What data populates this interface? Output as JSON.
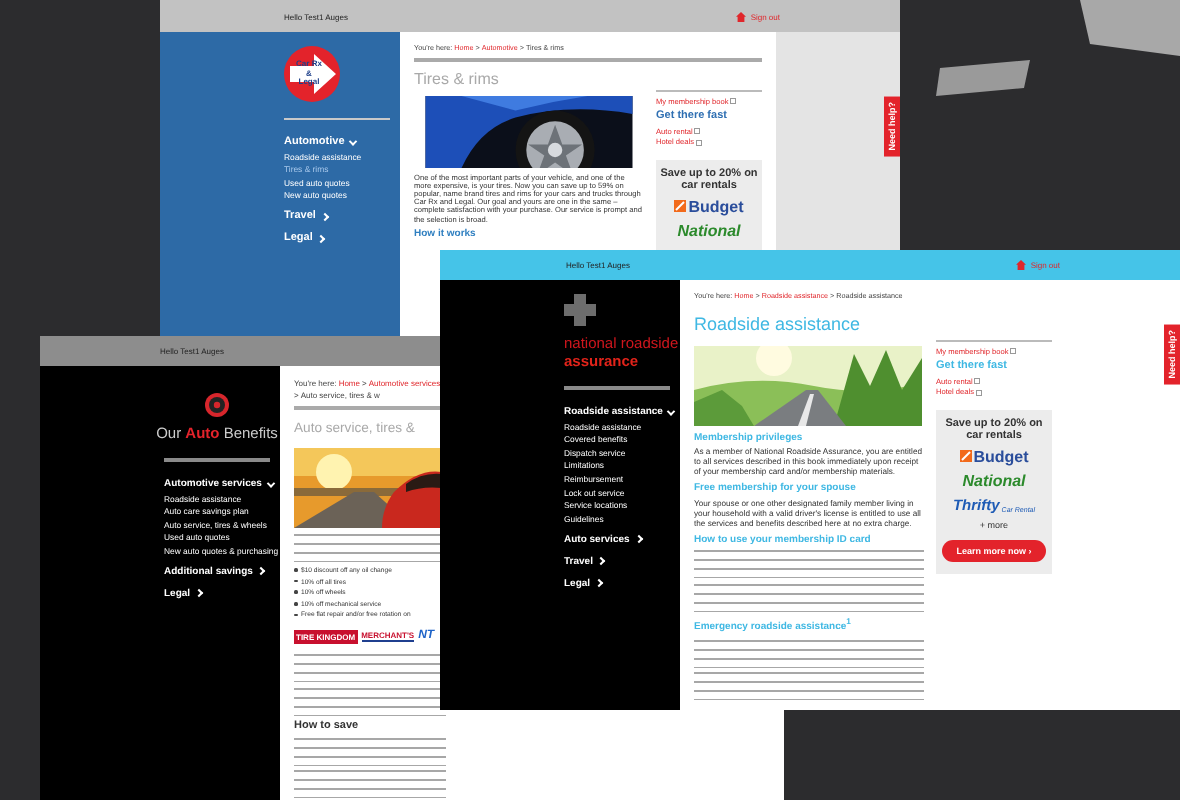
{
  "background": {
    "kind": "picture"
  },
  "pages": [
    {
      "kind": "carrx",
      "greeting": "Hello Test1 Auges",
      "sign_out": "Sign out",
      "logo": {
        "kind": "arrow_badge",
        "text": "Car Rx & Legal"
      },
      "nav": [
        {
          "label": "Automotive",
          "expanded": true,
          "children": [
            {
              "label": "Roadside assistance",
              "selected": false
            },
            {
              "label": "Tires & rims",
              "selected": true
            },
            {
              "label": "Used auto quotes",
              "selected": false
            },
            {
              "label": "New auto quotes",
              "selected": false
            }
          ]
        },
        {
          "label": "Travel",
          "expanded": false
        },
        {
          "label": "Legal",
          "expanded": false
        }
      ],
      "breadcrumb": [
        {
          "text": "You're here:",
          "kind": "plain"
        },
        {
          "text": "Home",
          "kind": "link"
        },
        {
          "text": ">",
          "kind": "plain"
        },
        {
          "text": "Automotive",
          "kind": "link"
        },
        {
          "text": ">",
          "kind": "plain"
        },
        {
          "text": "Tires & rims",
          "kind": "plain"
        }
      ],
      "title": "Tires & rims",
      "blocks": [
        {
          "kind": "picture"
        },
        {
          "kind": "paragraph",
          "text": "One of the most important parts of your vehicle, and one of the more expensive, is your tires. Now you can save up to 59% on popular, name brand tires and rims for your cars and trucks through Car Rx and Legal. Our goal and yours are one in the same – complete satisfaction with your purchase. Our service is prompt and the selection is broad."
        },
        {
          "kind": "heading",
          "text": "How it works"
        }
      ],
      "side_links": [
        {
          "kind": "link",
          "text": "My membership book"
        },
        {
          "kind": "heading",
          "text": "Get there fast"
        },
        {
          "kind": "link",
          "text": "Auto rental"
        },
        {
          "kind": "link",
          "text": "Hotel deals"
        }
      ],
      "ad": {
        "headline": "Save up to 20% on car rentals",
        "brands": [
          {
            "kind": "budget",
            "text": "Budget"
          },
          {
            "kind": "national",
            "text": "National"
          }
        ]
      },
      "help_tab": "Need help?"
    },
    {
      "kind": "benefits",
      "greeting": "Hello Test1 Auges",
      "logo": {
        "kind": "gear",
        "text": "Our **Auto** Benefits"
      },
      "nav": [
        {
          "label": "Automotive services",
          "expanded": true,
          "children": [
            {
              "label": "Roadside assistance",
              "selected": false
            },
            {
              "label": "Auto care savings plan",
              "selected": false
            },
            {
              "label": "Auto service, tires & wheels",
              "selected": false
            },
            {
              "label": "Used auto quotes",
              "selected": false
            },
            {
              "label": "New auto quotes & purchasing",
              "selected": false
            }
          ]
        },
        {
          "label": "Additional savings",
          "expanded": false
        },
        {
          "label": "Legal",
          "expanded": false
        }
      ],
      "breadcrumb": [
        {
          "text": "You're here:",
          "kind": "plain"
        },
        {
          "text": "Home",
          "kind": "link"
        },
        {
          "text": ">",
          "kind": "plain"
        },
        {
          "text": "Automotive services",
          "kind": "link"
        },
        {
          "text": ">",
          "kind": "plain"
        },
        {
          "text": "Auto service, tires & w",
          "kind": "plain"
        }
      ],
      "title": "Auto service, tires &",
      "blocks": [
        {
          "kind": "picture"
        },
        {
          "kind": "lines"
        },
        {
          "kind": "bullets",
          "items": [
            "$10 discount off any oil change",
            "10% off all tires",
            "10% off wheels",
            "10% off mechanical service",
            "Free flat repair and/or free rotation on"
          ]
        },
        {
          "kind": "brand_logos",
          "items": [
            {
              "kind": "tire_kingdom",
              "text": "TIRE KINGDOM"
            },
            {
              "kind": "merchants",
              "text": "MERCHANT'S"
            },
            {
              "kind": "ntb",
              "text": "NT"
            }
          ]
        },
        {
          "kind": "lines"
        },
        {
          "kind": "lines"
        },
        {
          "kind": "heading",
          "text": "How to save"
        },
        {
          "kind": "lines"
        },
        {
          "kind": "lines"
        }
      ]
    },
    {
      "kind": "roadside",
      "greeting": "Hello Test1 Auges",
      "sign_out": "Sign out",
      "logo": {
        "kind": "plus",
        "text": "national roadside",
        "tagline": "assurance"
      },
      "nav": [
        {
          "label": "Roadside assistance",
          "expanded": true,
          "children": [
            {
              "label": "Roadside assistance",
              "selected": false
            },
            {
              "label": "Covered benefits",
              "selected": false
            },
            {
              "label": "Dispatch service",
              "selected": false
            },
            {
              "label": "Limitations",
              "selected": false
            },
            {
              "label": "Reimbursement",
              "selected": false
            },
            {
              "label": "Lock out service",
              "selected": false
            },
            {
              "label": "Service locations",
              "selected": false
            },
            {
              "label": "Guidelines",
              "selected": false
            }
          ]
        },
        {
          "label": "Auto services",
          "expanded": false
        },
        {
          "label": "Travel",
          "expanded": false
        },
        {
          "label": "Legal",
          "expanded": false
        }
      ],
      "breadcrumb": [
        {
          "text": "You're here:",
          "kind": "plain"
        },
        {
          "text": "Home",
          "kind": "link"
        },
        {
          "text": ">",
          "kind": "plain"
        },
        {
          "text": "Roadside assistance",
          "kind": "link"
        },
        {
          "text": ">",
          "kind": "plain"
        },
        {
          "text": "Roadside assistance",
          "kind": "plain"
        }
      ],
      "title": "Roadside assistance",
      "blocks": [
        {
          "kind": "picture"
        },
        {
          "kind": "heading",
          "text": "Membership privileges"
        },
        {
          "kind": "paragraph",
          "text": "As a member of National Roadside Assurance, you are entitled to all services described in this book immediately upon receipt of your membership card and/or membership materials."
        },
        {
          "kind": "heading",
          "text": "Free membership for your spouse"
        },
        {
          "kind": "paragraph",
          "text": "Your spouse or one other designated family member living in your household with a valid driver's license is entitled to use all the services and benefits described here at no extra charge."
        },
        {
          "kind": "heading",
          "text": "How to use your membership ID card"
        },
        {
          "kind": "lines"
        },
        {
          "kind": "lines"
        },
        {
          "kind": "heading",
          "text": "Emergency roadside assistance$^{1}$"
        },
        {
          "kind": "lines"
        },
        {
          "kind": "lines"
        }
      ],
      "side_links": [
        {
          "kind": "link",
          "text": "My membership book"
        },
        {
          "kind": "heading",
          "text": "Get there fast"
        },
        {
          "kind": "link",
          "text": "Auto rental"
        },
        {
          "kind": "link",
          "text": "Hotel deals"
        }
      ],
      "ad": {
        "headline": "Save up to 20% on car rentals",
        "brands": [
          {
            "kind": "budget",
            "text": "Budget"
          },
          {
            "kind": "national",
            "text": "National"
          },
          {
            "kind": "thrifty",
            "text": "Thrifty",
            "sub": "Car Rental"
          }
        ],
        "more": "+ more",
        "button": "Learn more now ›"
      },
      "help_tab": "Need help?"
    }
  ]
}
